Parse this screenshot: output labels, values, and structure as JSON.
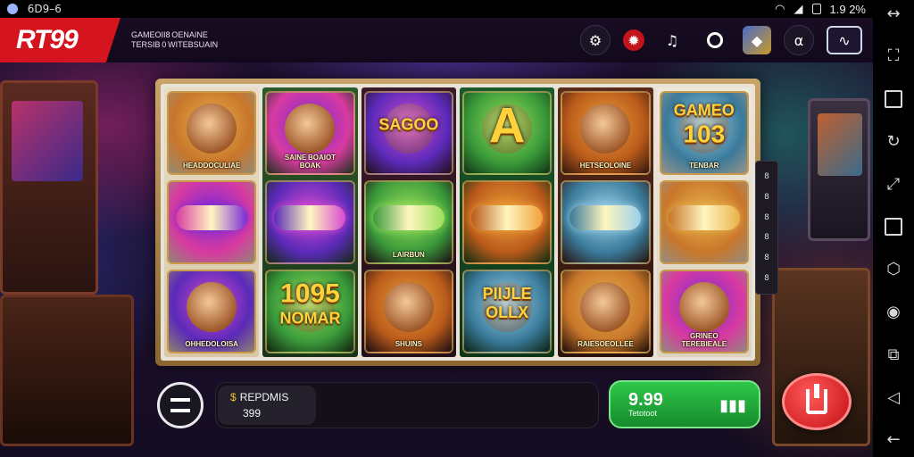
{
  "status_bar": {
    "left_text": "  6D9–6",
    "time": "1.9 2%"
  },
  "header": {
    "logo": "RT99",
    "tagline_line1": "GAMEOII8 OENAINE",
    "tagline_line2": "TERSIB 0 WITEBSUAIN"
  },
  "header_icons": [
    "settings-icon",
    "lucky-icon",
    "sound-icon",
    "circle-icon",
    "gem-icon",
    "info-icon",
    "chart-icon"
  ],
  "reels": [
    {
      "symbols": [
        {
          "name": "lion-symbol",
          "label": "HEADDOCULIAE"
        },
        {
          "name": "sword-orb-symbol",
          "label": ""
        },
        {
          "name": "potion-symbol",
          "label": "OHHEDOLOISA"
        }
      ]
    },
    {
      "symbols": [
        {
          "name": "heroine-symbol",
          "label": "SAINE BOAIOT\nBOAK"
        },
        {
          "name": "green-scroll-symbol",
          "label": ""
        },
        {
          "name": "jackpot-symbol",
          "label": "1095",
          "sub": "NOMAR"
        }
      ]
    },
    {
      "symbols": [
        {
          "name": "sago-symbol",
          "label": "SAGOO"
        },
        {
          "name": "purple-orb-symbol",
          "label": "LAIRBUN"
        },
        {
          "name": "dj-symbol",
          "label": "SHUINS"
        }
      ]
    },
    {
      "symbols": [
        {
          "name": "letter-a-symbol",
          "label": "A"
        },
        {
          "name": "purple-barrel-symbol",
          "label": ""
        },
        {
          "name": "pile-symbol",
          "label": "PIIJLE",
          "sub": "OLLX"
        }
      ]
    },
    {
      "symbols": [
        {
          "name": "warrior-symbol",
          "label": "HETSEOLOINE"
        },
        {
          "name": "horn-symbol",
          "label": ""
        },
        {
          "name": "tiger-symbol",
          "label": "RAIESOEOLLEE"
        }
      ]
    },
    {
      "symbols": [
        {
          "name": "game-logo-symbol",
          "label": "GAMEO",
          "sub": "103",
          "sub2": "TENBAR"
        },
        {
          "name": "green-sword-symbol",
          "label": ""
        },
        {
          "name": "cup-symbol",
          "label": "GRINEO",
          "sub": "TEREBIEALE"
        }
      ]
    }
  ],
  "side_panel": [
    "8",
    "8",
    "8",
    "8",
    "8",
    "8"
  ],
  "balance": {
    "coin_icon": "$",
    "label": "REPDMIS",
    "value": "399"
  },
  "win": {
    "amount": "9.99",
    "label": "Tetotoot"
  },
  "spin": {
    "label": "spin"
  },
  "nav": [
    "rotate-icon",
    "square-icon",
    "refresh-icon",
    "expand-icon",
    "square-icon",
    "shield-icon",
    "camera-icon",
    "copy-icon",
    "back-icon",
    "return-icon"
  ]
}
